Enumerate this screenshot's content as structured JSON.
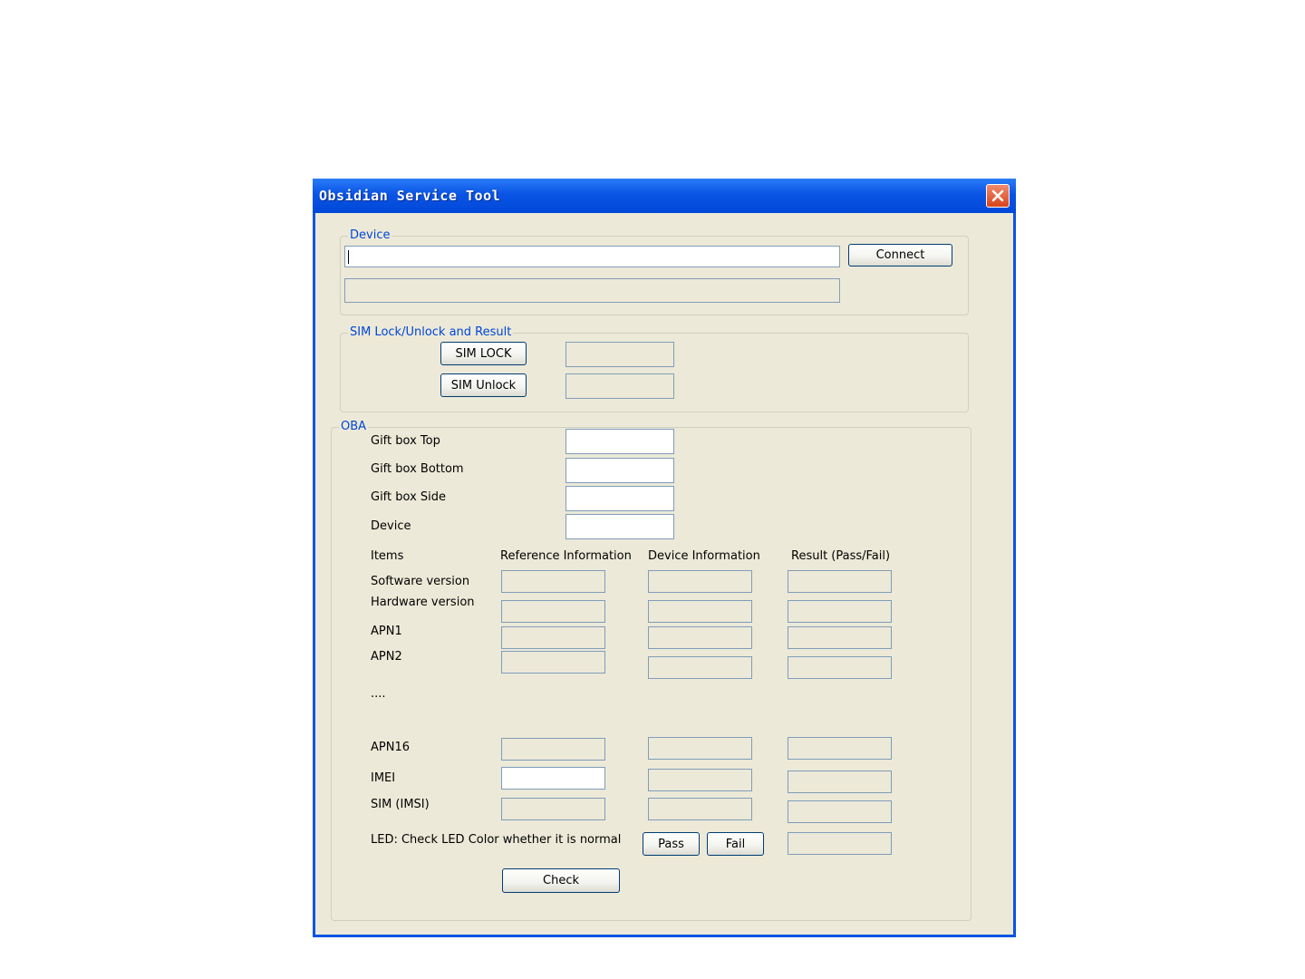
{
  "window": {
    "title": "Obsidian Service Tool"
  },
  "device_group": {
    "legend": "Device",
    "port_value": "",
    "status_value": "",
    "connect_label": "Connect"
  },
  "sim_group": {
    "legend": "SIM Lock/Unlock and Result",
    "lock_label": "SIM LOCK",
    "unlock_label": "SIM Unlock",
    "lock_result": "",
    "unlock_result": ""
  },
  "oba_group": {
    "legend": "OBA",
    "scan_rows": [
      {
        "label": "Gift box Top",
        "value": ""
      },
      {
        "label": "Gift box Bottom",
        "value": ""
      },
      {
        "label": "Gift box Side",
        "value": ""
      },
      {
        "label": "Device",
        "value": ""
      }
    ],
    "columns": [
      "Items",
      "Reference Information",
      "Device Information",
      "Result (Pass/Fail)"
    ],
    "rows": [
      {
        "label": "Software version",
        "reference": "",
        "device": "",
        "result": ""
      },
      {
        "label": "Hardware version",
        "reference": "",
        "device": "",
        "result": ""
      },
      {
        "label": "APN1",
        "reference": "",
        "device": "",
        "result": ""
      },
      {
        "label": "APN2",
        "reference": "",
        "device": "",
        "result": ""
      },
      {
        "label": "APN16",
        "reference": "",
        "device": "",
        "result": ""
      },
      {
        "label": "IMEI",
        "reference": "",
        "device": "",
        "result": ""
      },
      {
        "label": "SIM (IMSI)",
        "reference": "",
        "device": "",
        "result": ""
      }
    ],
    "ellipsis": "....",
    "led_label": "LED: Check LED Color whether it is normal",
    "pass_label": "Pass",
    "fail_label": "Fail",
    "led_result": "",
    "check_label": "Check"
  },
  "colors": {
    "titlebar": "#0a54e4",
    "window_bg": "#ece9d8",
    "legend_text": "#0046d5",
    "close_button": "#d9431a"
  },
  "icons": {
    "close": "close-x-icon"
  }
}
